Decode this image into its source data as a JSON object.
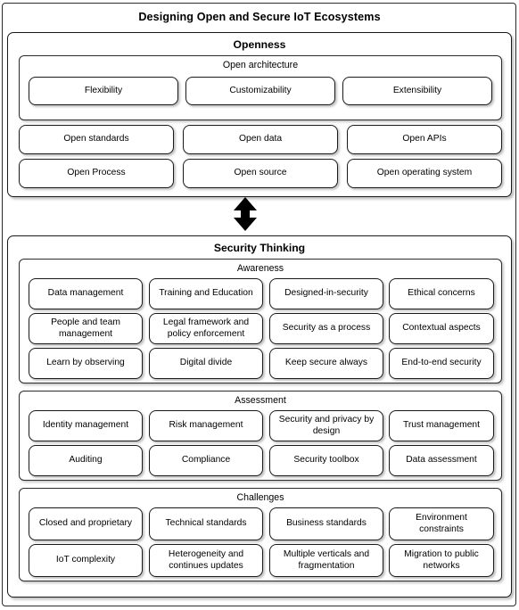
{
  "diagram": {
    "title": "Designing Open and Secure IoT Ecosystems",
    "connector": {
      "icon": "double-headed-vertical-arrow",
      "direction": "bidirectional"
    },
    "sections": [
      {
        "id": "openness",
        "title": "Openness",
        "groups": [
          {
            "id": "open-architecture",
            "title": "Open architecture",
            "columns": 3,
            "items": [
              "Flexibility",
              "Customizability",
              "Extensibility"
            ]
          }
        ],
        "loose_items": [
          "Open standards",
          "Open data",
          "Open APIs",
          "Open Process",
          "Open source",
          "Open operating system"
        ]
      },
      {
        "id": "security-thinking",
        "title": "Security Thinking",
        "groups": [
          {
            "id": "awareness",
            "title": "Awareness",
            "columns": 4,
            "items": [
              "Data management",
              "Training and Education",
              "Designed-in-security",
              "Ethical concerns",
              "People and team management",
              "Legal framework and policy enforcement",
              "Security as a process",
              "Contextual aspects",
              "Learn by observing",
              "Digital divide",
              "Keep secure always",
              "End-to-end security"
            ]
          },
          {
            "id": "assessment",
            "title": "Assessment",
            "columns": 4,
            "items": [
              "Identity management",
              "Risk management",
              "Security and privacy by design",
              "Trust management",
              "Auditing",
              "Compliance",
              "Security toolbox",
              "Data assessment"
            ]
          },
          {
            "id": "challenges",
            "title": "Challenges",
            "columns": 4,
            "items": [
              "Closed and proprietary",
              "Technical standards",
              "Business standards",
              "Environment constraints",
              "IoT complexity",
              "Heterogeneity and continues updates",
              "Multiple verticals and fragmentation",
              "Migration to public networks"
            ]
          }
        ]
      }
    ],
    "colors": {
      "background": "#ffffff",
      "border": "#1a1a1a",
      "text": "#000000",
      "shadow": "#888888"
    }
  }
}
